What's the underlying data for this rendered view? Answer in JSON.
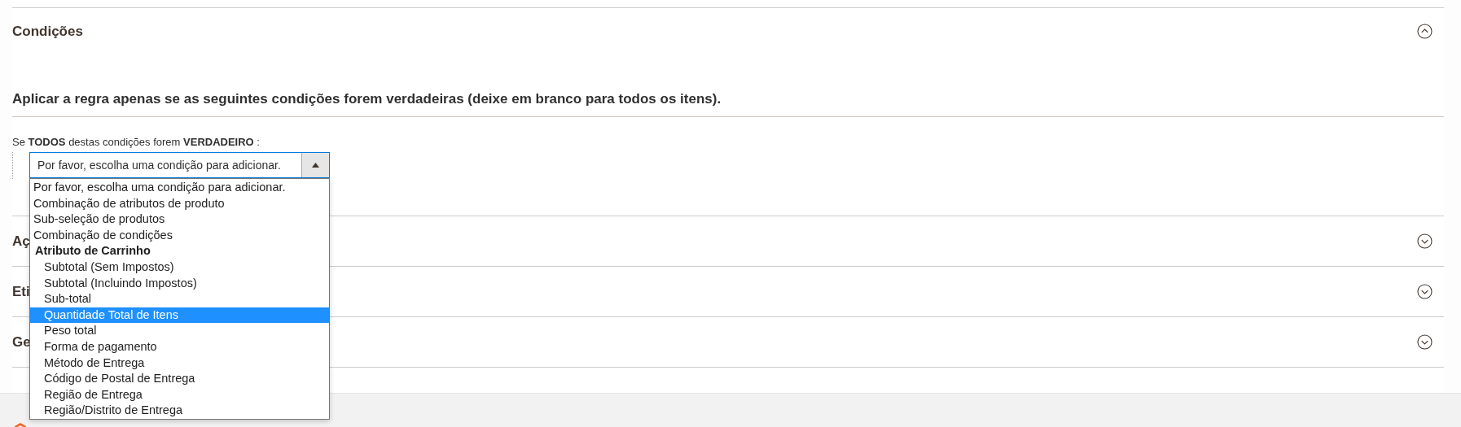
{
  "sections": [
    {
      "title": "Condições",
      "expanded": true
    },
    {
      "title": "Aç",
      "expanded": false
    },
    {
      "title": "Eti",
      "expanded": false
    },
    {
      "title": "Ge",
      "expanded": false
    }
  ],
  "conditions": {
    "heading": "Aplicar a regra apenas se as seguintes condições forem verdadeiras (deixe em branco para todos os itens).",
    "rule_sentence": "Se **TODOS**  destas condições forem **VERDADEIRO** :",
    "select": {
      "value": "Por favor, escolha uma condição para adicionar.",
      "expanded": true
    },
    "options": [
      {
        "kind": "option",
        "label": "Por favor, escolha uma condição para adicionar.",
        "selected": false
      },
      {
        "kind": "option",
        "label": "Combinação de atributos de produto",
        "selected": false
      },
      {
        "kind": "option",
        "label": "Sub-seleção de produtos",
        "selected": false
      },
      {
        "kind": "option",
        "label": "Combinação de condições",
        "selected": false
      },
      {
        "kind": "group",
        "label": "Atributo de Carrinho",
        "children": [
          {
            "label": "Subtotal (Sem Impostos)",
            "selected": false
          },
          {
            "label": "Subtotal (Incluindo Impostos)",
            "selected": false
          },
          {
            "label": "Sub-total",
            "selected": false
          },
          {
            "label": "Quantidade Total de Itens",
            "selected": true
          },
          {
            "label": "Peso total",
            "selected": false
          },
          {
            "label": "Forma de pagamento",
            "selected": false
          },
          {
            "label": "Método de Entrega",
            "selected": false
          },
          {
            "label": "Código de Postal de Entrega",
            "selected": false
          },
          {
            "label": "Região de Entrega",
            "selected": false
          },
          {
            "label": "Região/Distrito de Entrega",
            "selected": false
          }
        ]
      }
    ]
  }
}
